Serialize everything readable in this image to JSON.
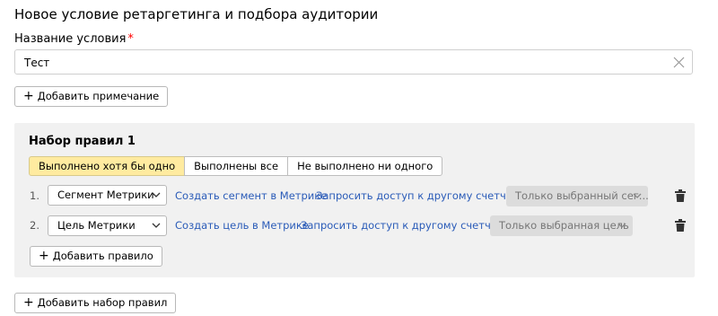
{
  "page": {
    "title": "Новое условие ретаргетинга и подбора аудитории"
  },
  "condition_name": {
    "label": "Название условия",
    "required_mark": "*",
    "value": "Тест"
  },
  "add_note_button": {
    "plus": "+",
    "label": "Добавить примечание"
  },
  "ruleset": {
    "title": "Набор правил 1",
    "match_options": [
      "Выполнено хотя бы одно",
      "Выполнены все",
      "Не выполнено ни одного"
    ],
    "selected_option": "Выполнено хотя бы одно",
    "rules": [
      {
        "number": "1.",
        "type": "Сегмент Метрики",
        "create_link": "Создать сегмент в Метрике",
        "access_link": "Запросить доступ к другому счетчику",
        "scope": "Только выбранный сег..."
      },
      {
        "number": "2.",
        "type": "Цель Метрики",
        "create_link": "Создать цель в Метрике",
        "access_link": "Запросить доступ к другому счетчику",
        "scope": "Только выбранная цель"
      }
    ],
    "add_rule_button": {
      "plus": "+",
      "label": "Добавить правило"
    }
  },
  "add_ruleset_button": {
    "plus": "+",
    "label": "Добавить набор правил"
  },
  "icons": {
    "clear": "close-icon",
    "chevron": "chevron-down-icon",
    "delete": "trash-icon"
  },
  "colors": {
    "active_option": "#ffeba0",
    "link": "#2a5bb8",
    "required": "#ff0000",
    "panel": "#f1f1f1"
  }
}
